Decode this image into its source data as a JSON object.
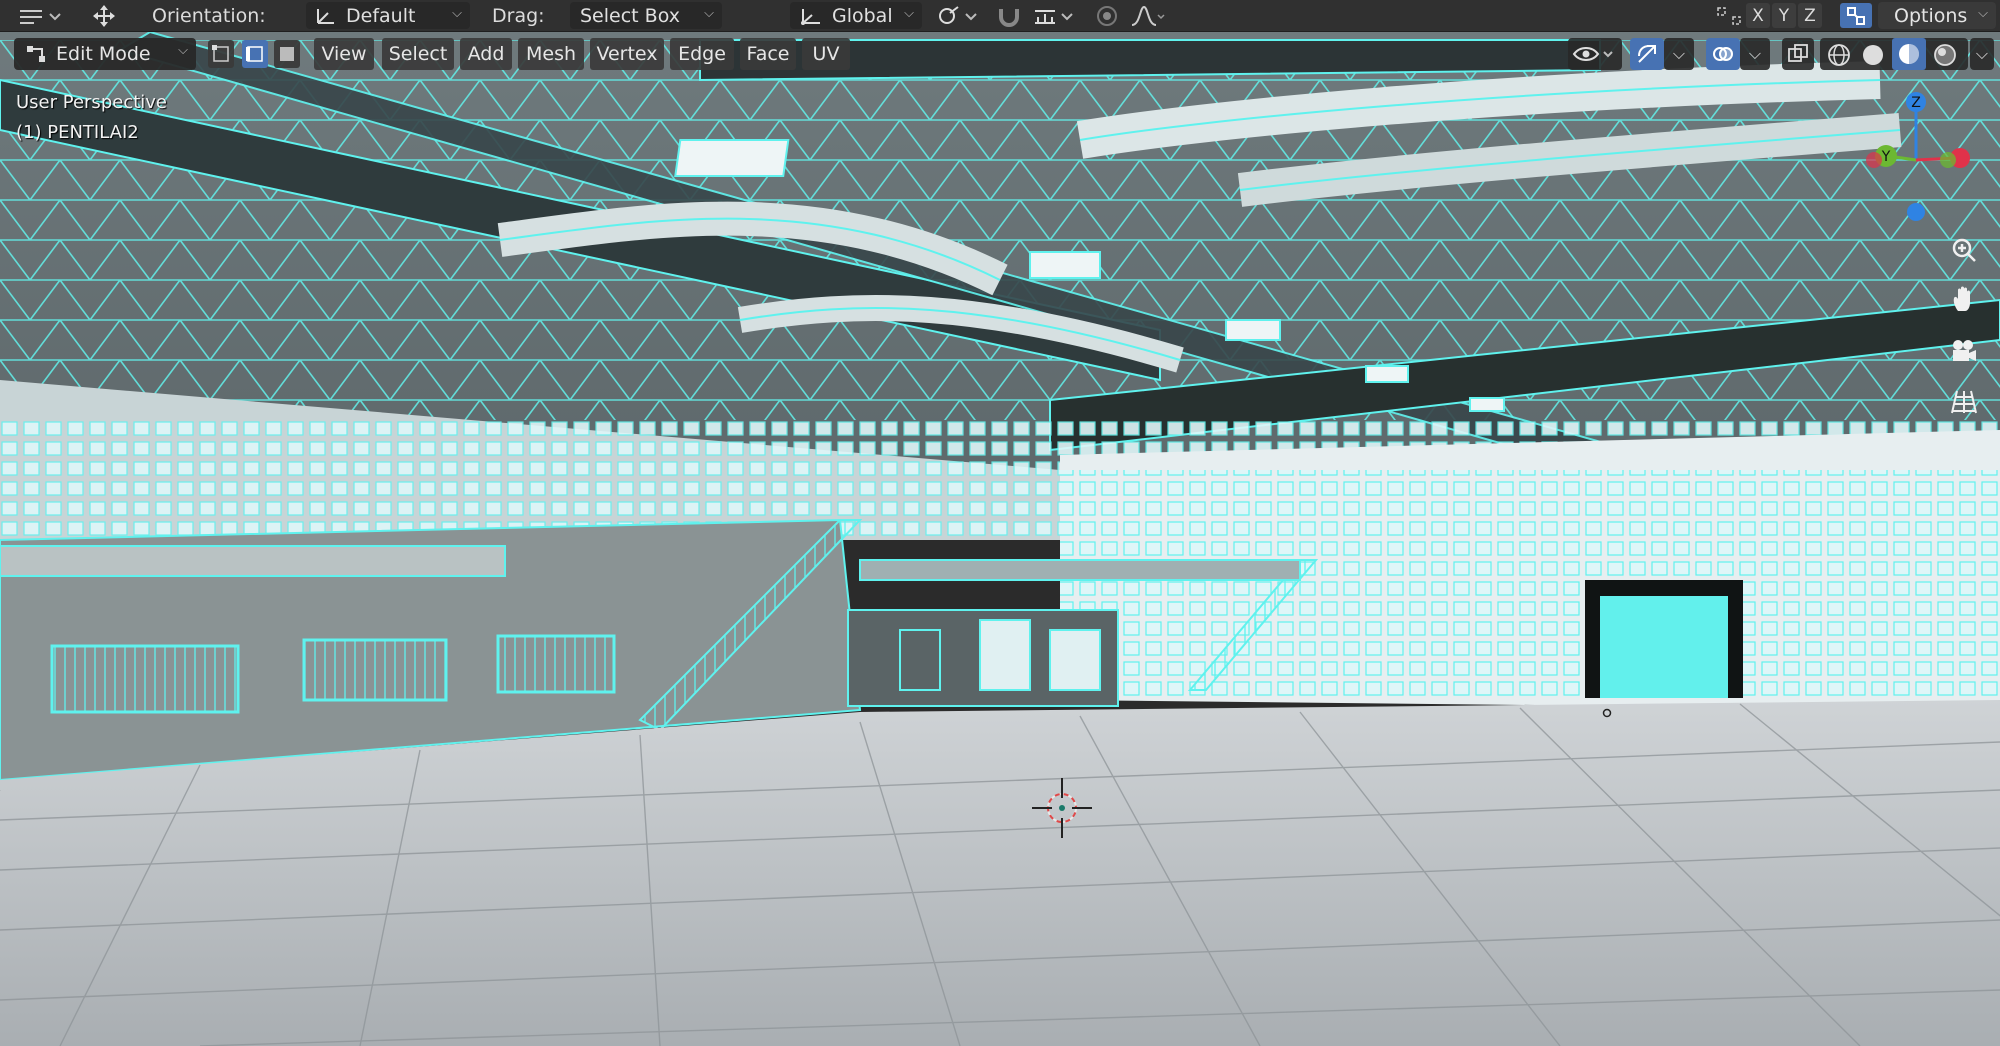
{
  "topbar": {
    "orientation_label": "Orientation:",
    "orientation_value": "Default",
    "drag_label": "Drag:",
    "drag_value": "Select Box",
    "transform_orientation": "Global",
    "axis_x": "X",
    "axis_y": "Y",
    "axis_z": "Z",
    "options_label": "Options"
  },
  "header": {
    "mode": "Edit Mode",
    "menus": [
      "View",
      "Select",
      "Add",
      "Mesh",
      "Vertex",
      "Edge",
      "Face",
      "UV"
    ]
  },
  "viewport": {
    "view_name": "User Perspective",
    "object_name": "(1) PENTILAI2",
    "gizmo_axes": [
      "Z",
      "Y"
    ]
  },
  "colors": {
    "wire": "#5ff2ee",
    "active_blue": "#4772b3",
    "gizmo_x": "#e0324a",
    "gizmo_y": "#6cb832",
    "gizmo_z": "#2f83e3"
  },
  "icons": {
    "grip": "move-icon",
    "orientation": "orientation-icon",
    "snap": "magnet-icon",
    "proportional": "proportional-icon",
    "mirror": "mirror-icon",
    "overlays": "overlays-icon",
    "shading": "shading-icon",
    "zoom": "zoom-icon",
    "pan": "hand-icon",
    "camera": "camera-icon",
    "grid": "grid-icon"
  }
}
